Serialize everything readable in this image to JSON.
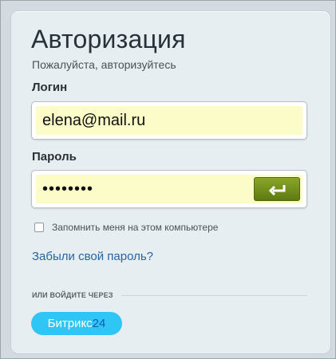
{
  "auth": {
    "title": "Авторизация",
    "subtitle": "Пожалуйста, авторизуйтесь",
    "login_label": "Логин",
    "login_value": "elena@mail.ru",
    "password_label": "Пароль",
    "password_value": "••••••••",
    "remember_label": "Запомнить меня на этом компьютере",
    "remember_checked": false,
    "forgot_link": "Забыли свой пароль?",
    "or_label": "ИЛИ ВОЙДИТЕ ЧЕРЕЗ",
    "bitrix_text": "Битрикс",
    "bitrix_num": "24"
  },
  "colors": {
    "input_bg": "#fbfcc7",
    "enter_button": "#6f8d18",
    "link": "#2564a6",
    "bitrix_bg": "#2fc6f6",
    "bitrix_num": "#0b5db2"
  },
  "icons": {
    "enter": "enter-arrow-icon"
  }
}
